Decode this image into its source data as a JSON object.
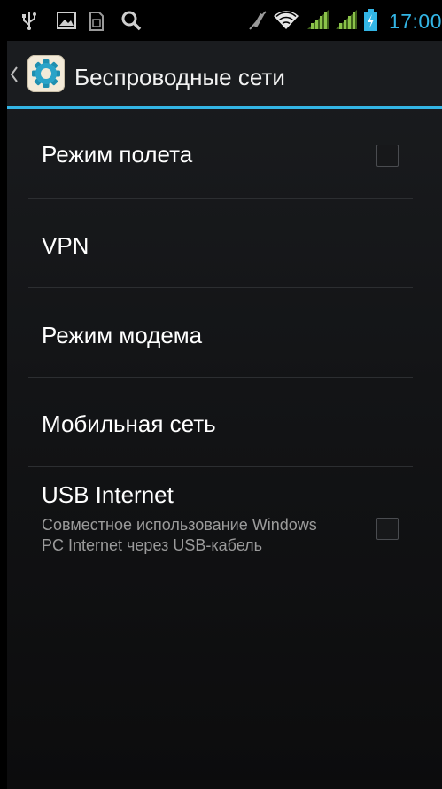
{
  "status_bar": {
    "time": "17:00",
    "icons": [
      "usb-icon",
      "image-icon",
      "sim-card-icon",
      "search-icon",
      "mute-icon",
      "wifi-icon",
      "signal-1-icon",
      "signal-2-icon",
      "battery-charging-icon"
    ],
    "accent_color": "#33b5e5"
  },
  "action_bar": {
    "title": "Беспроводные сети",
    "icon": "settings-gear-icon"
  },
  "items": [
    {
      "title": "Режим полета",
      "has_checkbox": true,
      "checked": false
    },
    {
      "title": "VPN"
    },
    {
      "title": "Режим модема"
    },
    {
      "title": "Мобильная сеть"
    },
    {
      "title": "USB Internet",
      "summary": "Совместное использование Windows PC Internet через USB-кабель",
      "has_checkbox": true,
      "checked": false
    }
  ]
}
